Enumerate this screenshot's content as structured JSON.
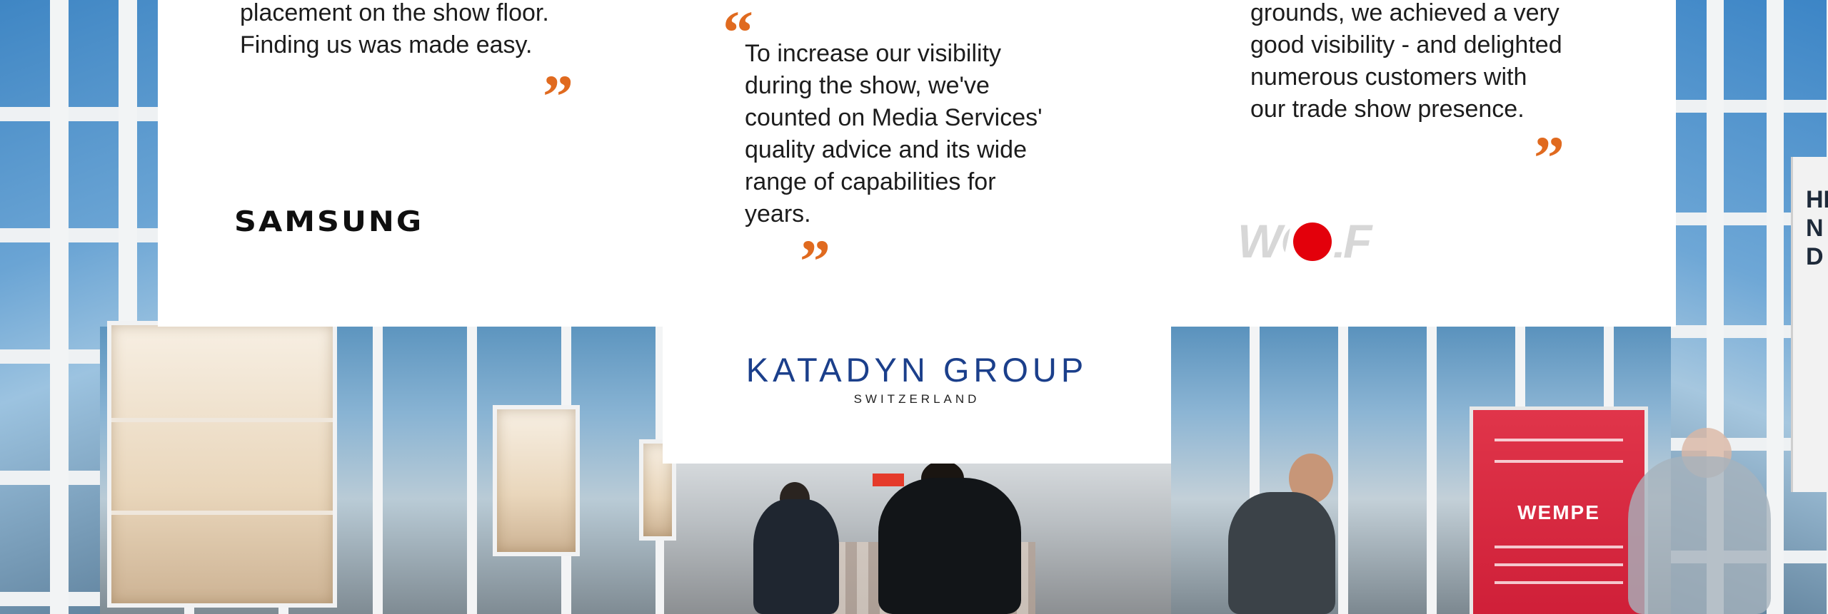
{
  "testimonials": [
    {
      "lines": [
        "placement on the show floor.",
        "Finding us was made easy."
      ],
      "company": "SAMSUNG"
    },
    {
      "lines": [
        "To increase our visibility",
        "during the show, we've",
        "counted on Media Services'",
        "quality advice and its wide",
        "range of capabilities for",
        "years."
      ]
    },
    {
      "lines": [
        "grounds, we achieved a very",
        "good visibility - and delighted",
        "numerous customers with",
        "our trade show presence."
      ],
      "company": "WOLF"
    }
  ],
  "quote_marks": {
    "open": "“",
    "close": "”"
  },
  "featured_logo": {
    "name": "KATADYN GROUP",
    "subtitle": "SWITZERLAND"
  },
  "background_signage": {
    "ad_brand": "WEMPE",
    "stand_text": "HI N D"
  },
  "colors": {
    "accent_quote": "#e06a1f",
    "katadyn_blue": "#1b3f8b",
    "wolf_red": "#e3000b",
    "wolf_gray": "#d7d7d7",
    "panel": "#ffffff"
  }
}
